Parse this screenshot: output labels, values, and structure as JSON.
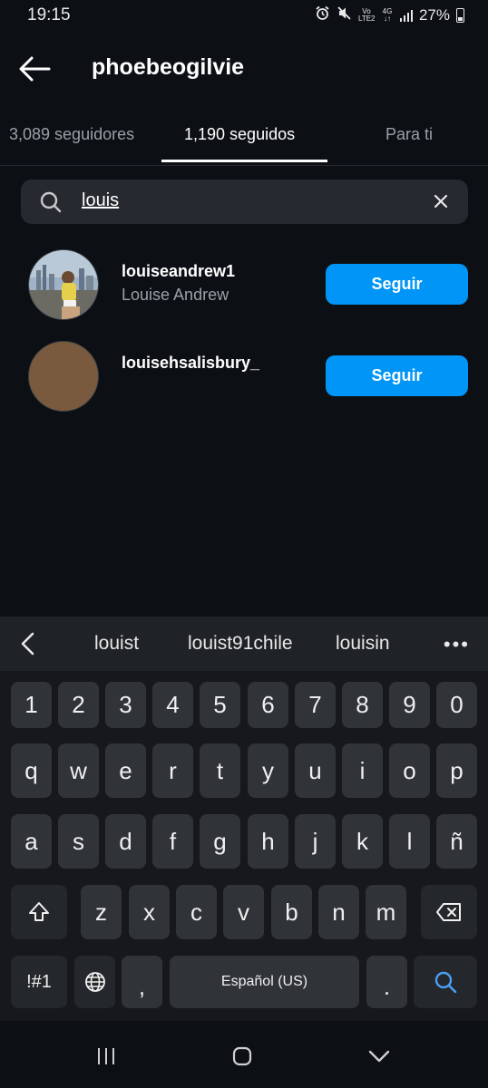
{
  "status_bar": {
    "time": "19:15",
    "volte_label": "Vo LTE2",
    "network": "4G",
    "battery": "27%"
  },
  "header": {
    "title": "phoebeogilvie"
  },
  "tabs": [
    {
      "label": "3,089 seguidores"
    },
    {
      "label": "1,190 seguidos"
    },
    {
      "label": "Para ti"
    }
  ],
  "search": {
    "query": "louis"
  },
  "results": [
    {
      "username": "louiseandrew1",
      "full_name": "Louise Andrew",
      "button": "Seguir"
    },
    {
      "username": "louisehsalisbury_",
      "full_name": "",
      "button": "Seguir"
    }
  ],
  "suggestions": [
    "louist",
    "louist91chile",
    "louisin"
  ],
  "keyboard": {
    "number_row": [
      "1",
      "2",
      "3",
      "4",
      "5",
      "6",
      "7",
      "8",
      "9",
      "0"
    ],
    "row1": [
      "q",
      "w",
      "e",
      "r",
      "t",
      "y",
      "u",
      "i",
      "o",
      "p"
    ],
    "row2": [
      "a",
      "s",
      "d",
      "f",
      "g",
      "h",
      "j",
      "k",
      "l",
      "ñ"
    ],
    "row3": [
      "z",
      "x",
      "c",
      "v",
      "b",
      "n",
      "m"
    ],
    "symbols_key": "!#1",
    "comma": ",",
    "space_label": "Español (US)",
    "period": "."
  },
  "colors": {
    "background": "#0c1014",
    "accent": "#0095f6",
    "search_field": "#262a30"
  }
}
